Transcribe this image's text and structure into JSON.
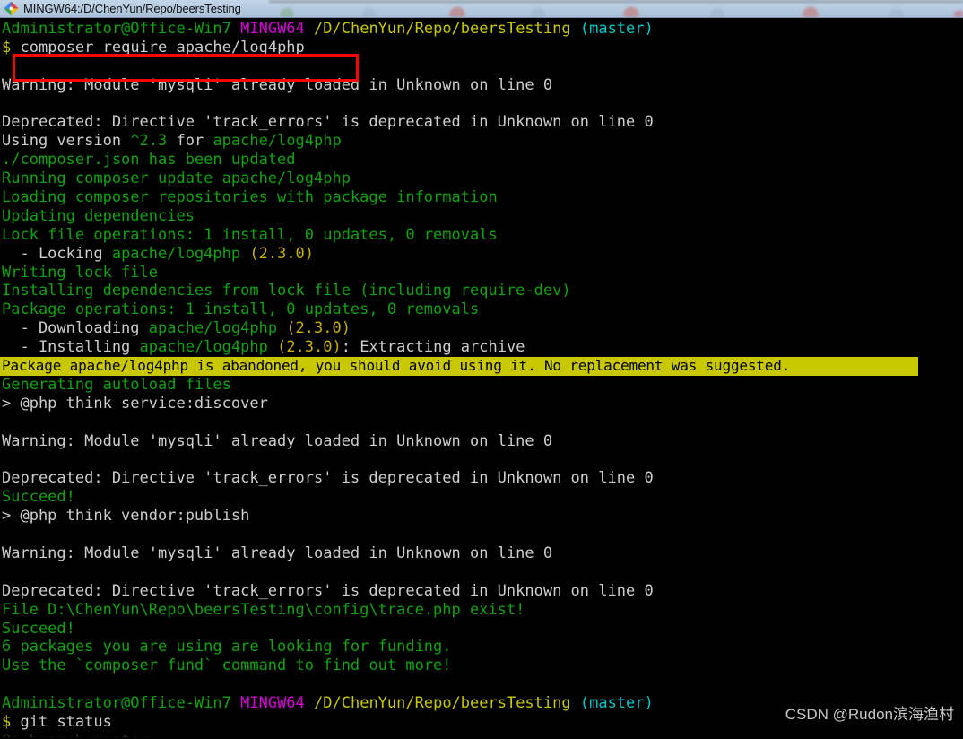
{
  "window": {
    "title": "MINGW64:/D/ChenYun/Repo/beersTesting",
    "icon": "git-bash-icon"
  },
  "colors": {
    "background": "#000000",
    "foreground": "#cccccc",
    "green": "#12a112",
    "yellow": "#c7b000",
    "magenta": "#d600d6",
    "cyan": "#00c5c7",
    "highlight_bg": "#c9c800",
    "annotation_red": "#ff0000",
    "titlebar_bg": "#b4c9de"
  },
  "prompt": {
    "user_host": "Administrator@Office-Win7",
    "shell": "MINGW64",
    "path": "/D/ChenYun/Repo/beersTesting",
    "branch": "(master)",
    "symbol": "$"
  },
  "annotation": {
    "type": "red-rectangle",
    "targets_command": "composer require apache/log4php"
  },
  "watermark": "CSDN @Rudon滨海渔村",
  "terminal_lines": [
    {
      "id": "prompt-1",
      "kind": "prompt"
    },
    {
      "id": "cmd-1",
      "kind": "command",
      "symbol": "$",
      "text": "composer require apache/log4php"
    },
    {
      "id": "blank-1",
      "kind": "blank"
    },
    {
      "id": "out-1",
      "kind": "plain",
      "color": "white",
      "text": "Warning: Module 'mysqli' already loaded in Unknown on line 0"
    },
    {
      "id": "blank-2",
      "kind": "blank"
    },
    {
      "id": "out-2",
      "kind": "plain",
      "color": "white",
      "text": "Deprecated: Directive 'track_errors' is deprecated in Unknown on line 0"
    },
    {
      "id": "out-3",
      "kind": "mixed",
      "parts": [
        {
          "text": "Using version ",
          "color": "white"
        },
        {
          "text": "^2.3",
          "color": "green"
        },
        {
          "text": " for ",
          "color": "white"
        },
        {
          "text": "apache/log4php",
          "color": "green"
        }
      ]
    },
    {
      "id": "out-4",
      "kind": "plain",
      "color": "green",
      "text": "./composer.json has been updated"
    },
    {
      "id": "out-5",
      "kind": "plain",
      "color": "green",
      "text": "Running composer update apache/log4php"
    },
    {
      "id": "out-6",
      "kind": "plain",
      "color": "green",
      "text": "Loading composer repositories with package information"
    },
    {
      "id": "out-7",
      "kind": "plain",
      "color": "green",
      "text": "Updating dependencies"
    },
    {
      "id": "out-8",
      "kind": "plain",
      "color": "green",
      "text": "Lock file operations: 1 install, 0 updates, 0 removals"
    },
    {
      "id": "out-9",
      "kind": "mixed",
      "parts": [
        {
          "text": "  - Locking ",
          "color": "white"
        },
        {
          "text": "apache/log4php",
          "color": "green"
        },
        {
          "text": " ",
          "color": "white"
        },
        {
          "text": "(2.3.0)",
          "color": "yellow"
        }
      ]
    },
    {
      "id": "out-10",
      "kind": "plain",
      "color": "green",
      "text": "Writing lock file"
    },
    {
      "id": "out-11",
      "kind": "plain",
      "color": "green",
      "text": "Installing dependencies from lock file (including require-dev)"
    },
    {
      "id": "out-12",
      "kind": "plain",
      "color": "green",
      "text": "Package operations: 1 install, 0 updates, 0 removals"
    },
    {
      "id": "out-13",
      "kind": "mixed",
      "parts": [
        {
          "text": "  - Downloading ",
          "color": "white"
        },
        {
          "text": "apache/log4php",
          "color": "green"
        },
        {
          "text": " ",
          "color": "white"
        },
        {
          "text": "(2.3.0)",
          "color": "yellow"
        }
      ]
    },
    {
      "id": "out-14",
      "kind": "mixed",
      "parts": [
        {
          "text": "  - Installing ",
          "color": "white"
        },
        {
          "text": "apache/log4php",
          "color": "green"
        },
        {
          "text": " ",
          "color": "white"
        },
        {
          "text": "(2.3.0)",
          "color": "yellow"
        },
        {
          "text": ": Extracting archive",
          "color": "white"
        }
      ]
    },
    {
      "id": "out-15",
      "kind": "highlight",
      "text": "Package apache/log4php is abandoned, you should avoid using it. No replacement was suggested."
    },
    {
      "id": "out-16",
      "kind": "plain",
      "color": "green",
      "text": "Generating autoload files"
    },
    {
      "id": "out-17",
      "kind": "plain",
      "color": "white",
      "text": "> @php think service:discover"
    },
    {
      "id": "blank-3",
      "kind": "blank"
    },
    {
      "id": "out-18",
      "kind": "plain",
      "color": "white",
      "text": "Warning: Module 'mysqli' already loaded in Unknown on line 0"
    },
    {
      "id": "blank-4",
      "kind": "blank"
    },
    {
      "id": "out-19",
      "kind": "plain",
      "color": "white",
      "text": "Deprecated: Directive 'track_errors' is deprecated in Unknown on line 0"
    },
    {
      "id": "out-20",
      "kind": "plain",
      "color": "green",
      "text": "Succeed!"
    },
    {
      "id": "out-21",
      "kind": "plain",
      "color": "white",
      "text": "> @php think vendor:publish"
    },
    {
      "id": "blank-5",
      "kind": "blank"
    },
    {
      "id": "out-22",
      "kind": "plain",
      "color": "white",
      "text": "Warning: Module 'mysqli' already loaded in Unknown on line 0"
    },
    {
      "id": "blank-6",
      "kind": "blank"
    },
    {
      "id": "out-23",
      "kind": "plain",
      "color": "white",
      "text": "Deprecated: Directive 'track_errors' is deprecated in Unknown on line 0"
    },
    {
      "id": "out-24",
      "kind": "plain",
      "color": "green",
      "text": "File D:\\ChenYun\\Repo\\beersTesting\\config\\trace.php exist!"
    },
    {
      "id": "out-25",
      "kind": "plain",
      "color": "green",
      "text": "Succeed!"
    },
    {
      "id": "out-26",
      "kind": "plain",
      "color": "green",
      "text": "6 packages you are using are looking for funding."
    },
    {
      "id": "out-27",
      "kind": "plain",
      "color": "green",
      "text": "Use the `composer fund` command to find out more!"
    },
    {
      "id": "blank-7",
      "kind": "blank"
    },
    {
      "id": "prompt-2",
      "kind": "prompt"
    },
    {
      "id": "cmd-2",
      "kind": "command",
      "symbol": "$",
      "text": "git status"
    },
    {
      "id": "clipped-1",
      "kind": "clipped",
      "text": "On branch master"
    }
  ]
}
